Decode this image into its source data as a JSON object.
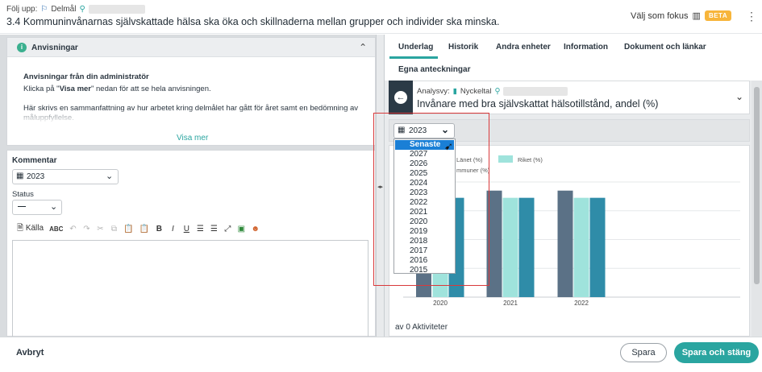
{
  "header": {
    "crumb_label": "Följ upp:",
    "crumb_item": "Delmål",
    "title": "3.4 Kommuninvånarnas självskattade hälsa ska öka och skillnaderna mellan grupper och individer ska minska.",
    "focus_label": "Välj som fokus",
    "beta": "BETA"
  },
  "anvisningar": {
    "title": "Anvisningar",
    "subtitle": "Anvisningar från din administratör",
    "line1_a": "Klicka på \"",
    "line1_b": "Visa mer",
    "line1_c": "\" nedan för att se hela anvisningen.",
    "line2": "Här skrivs en sammanfattning av hur arbetet kring delmålet har gått för året samt en bedömning av måluppfyllelse.",
    "more": "Visa mer"
  },
  "kommentar": {
    "title": "Kommentar",
    "year": "2023",
    "status_label": "Status",
    "status_value": "—",
    "source_label": "Källa"
  },
  "tabs": [
    "Underlag",
    "Historik",
    "Andra enheter",
    "Information",
    "Dokument och länkar",
    "Egna anteckningar"
  ],
  "card": {
    "analysvy_label": "Analysvy:",
    "nyckeltal_label": "Nyckeltal",
    "title": "Invånare med bra självskattat hälsotillstånd, andel (%)"
  },
  "year_dropdown": {
    "value": "2023",
    "options": [
      "Senaste",
      "2027",
      "2026",
      "2025",
      "2024",
      "2023",
      "2022",
      "2021",
      "2020",
      "2019",
      "2018",
      "2017",
      "2016",
      "2015"
    ],
    "selected_index": 0
  },
  "chart_data": {
    "type": "bar",
    "categories": [
      "2020",
      "2021",
      "2022"
    ],
    "series": [
      {
        "name": "Länet (%)",
        "color": "#5b7186",
        "values": [
          null,
          74,
          74
        ]
      },
      {
        "name": "Riket (%)",
        "color": "#9fe3dc",
        "values": [
          69,
          69,
          69
        ]
      },
      {
        "name": "mmuner (%)",
        "color": "#2f8ca8",
        "values": [
          69,
          69,
          69
        ]
      }
    ],
    "ylim": [
      0,
      80
    ]
  },
  "activity": "av 0 Aktiviteter",
  "footer": {
    "cancel": "Avbryt",
    "save": "Spara",
    "save_close": "Spara och stäng"
  }
}
